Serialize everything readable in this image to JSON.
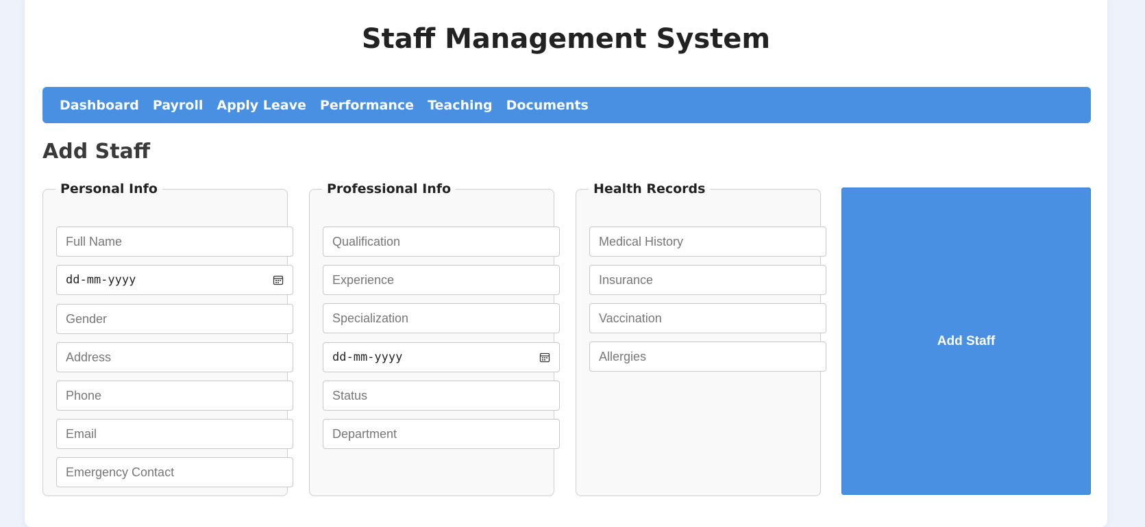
{
  "header": {
    "title": "Staff Management System"
  },
  "nav": {
    "items": [
      {
        "label": "Dashboard"
      },
      {
        "label": "Payroll"
      },
      {
        "label": "Apply Leave"
      },
      {
        "label": "Performance"
      },
      {
        "label": "Teaching"
      },
      {
        "label": "Documents"
      }
    ]
  },
  "form": {
    "title": "Add Staff",
    "personal": {
      "legend": "Personal Info",
      "full_name": "Full Name",
      "dob": "dd-mm-yyyy",
      "gender": "Gender",
      "address": "Address",
      "phone": "Phone",
      "email": "Email",
      "emergency": "Emergency Contact"
    },
    "professional": {
      "legend": "Professional Info",
      "qualification": "Qualification",
      "experience": "Experience",
      "specialization": "Specialization",
      "join_date": "dd-mm-yyyy",
      "status": "Status",
      "department": "Department"
    },
    "health": {
      "legend": "Health Records",
      "medical_history": "Medical History",
      "insurance": "Insurance",
      "vaccination": "Vaccination",
      "allergies": "Allergies"
    },
    "submit_label": "Add Staff"
  },
  "colors": {
    "accent": "#4a90e2",
    "background": "#eef2fb"
  },
  "icons": {
    "date_picker": "calendar-icon"
  }
}
